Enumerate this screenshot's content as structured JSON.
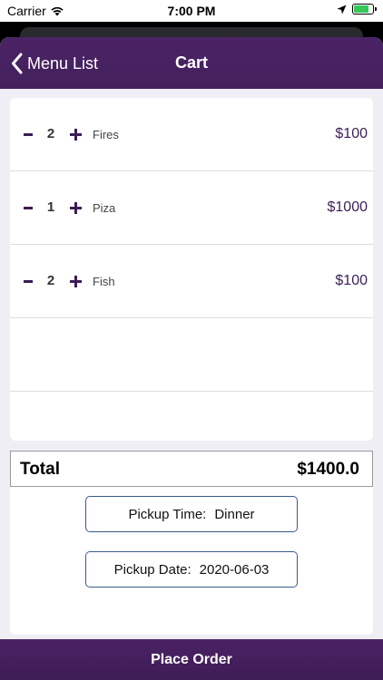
{
  "status_bar": {
    "carrier": "Carrier",
    "time": "7:00 PM",
    "battery_level": 0.8
  },
  "nav": {
    "back_label": "Menu List",
    "title": "Cart"
  },
  "cart": {
    "items": [
      {
        "qty": "2",
        "name": "Fires",
        "price": "$100"
      },
      {
        "qty": "1",
        "name": "Piza",
        "price": "$1000"
      },
      {
        "qty": "2",
        "name": "Fish",
        "price": "$100"
      }
    ],
    "minus_label": "-",
    "plus_label": "+"
  },
  "total": {
    "label": "Total",
    "value": "$1400.0"
  },
  "pickup": {
    "time_label": "Pickup Time:",
    "time_value": "Dinner",
    "date_label": "Pickup Date:",
    "date_value": "2020-06-03"
  },
  "place_order_label": "Place Order",
  "colors": {
    "brand_purple": "#4b2366",
    "battery_green": "#34c759"
  }
}
